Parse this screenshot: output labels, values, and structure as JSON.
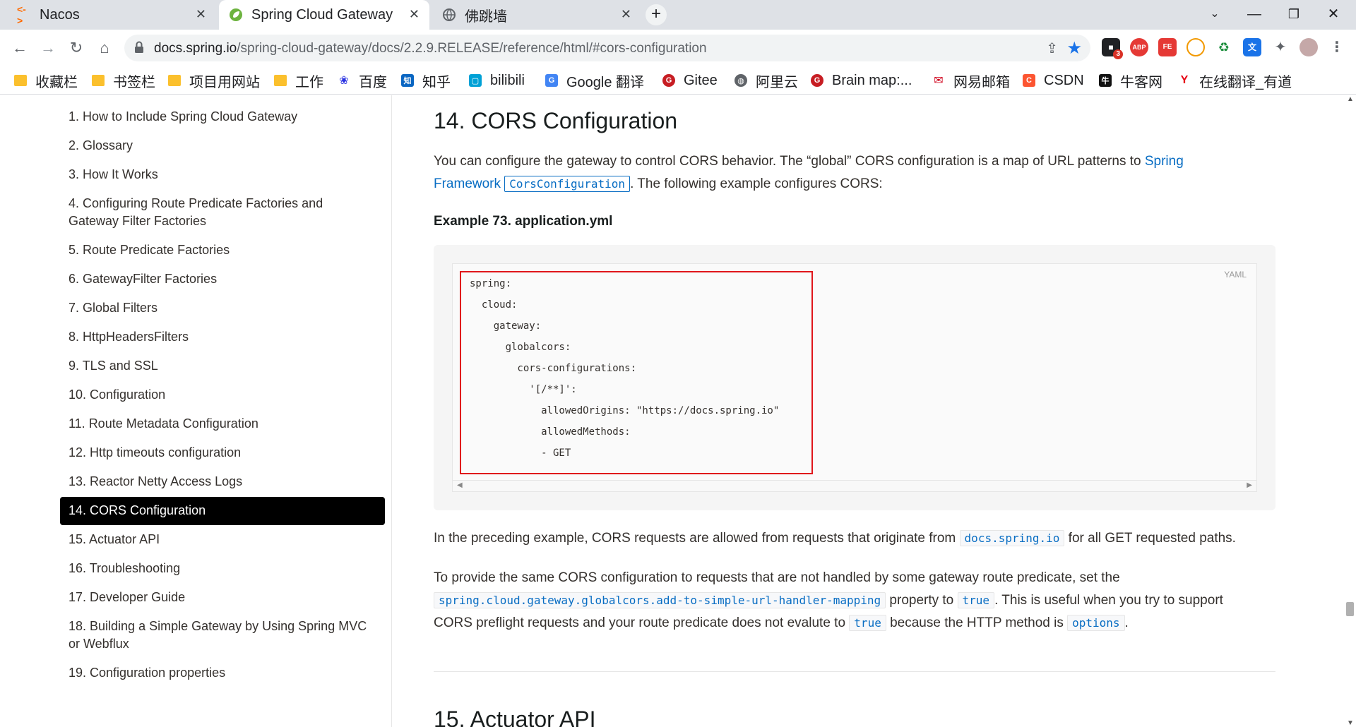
{
  "tabs": [
    {
      "title": "Nacos",
      "icon": "nacos-icon"
    },
    {
      "title": "Spring Cloud Gateway",
      "icon": "spring-leaf-icon"
    },
    {
      "title": "佛跳墙",
      "icon": "globe-icon"
    }
  ],
  "address": {
    "host": "docs.spring.io",
    "path": "/spring-cloud-gateway/docs/2.2.9.RELEASE/reference/html/#cors-configuration"
  },
  "extensions": {
    "badge_count": "3",
    "abp": "ABP",
    "fe": "FE"
  },
  "bookmarks": [
    "收藏栏",
    "书签栏",
    "项目用网站",
    "工作",
    "百度",
    "知乎",
    "bilibili",
    "Google 翻译",
    "Gitee",
    "阿里云",
    "Brain map:...",
    "网易邮箱",
    "CSDN",
    "牛客网",
    "在线翻译_有道"
  ],
  "toc": [
    {
      "label": "1. How to Include Spring Cloud Gateway",
      "active": false
    },
    {
      "label": "2. Glossary",
      "active": false
    },
    {
      "label": "3. How It Works",
      "active": false
    },
    {
      "label": "4. Configuring Route Predicate Factories and Gateway Filter Factories",
      "active": false
    },
    {
      "label": "5. Route Predicate Factories",
      "active": false
    },
    {
      "label": "6. GatewayFilter Factories",
      "active": false
    },
    {
      "label": "7. Global Filters",
      "active": false
    },
    {
      "label": "8. HttpHeadersFilters",
      "active": false
    },
    {
      "label": "9. TLS and SSL",
      "active": false
    },
    {
      "label": "10. Configuration",
      "active": false
    },
    {
      "label": "11. Route Metadata Configuration",
      "active": false
    },
    {
      "label": "12. Http timeouts configuration",
      "active": false
    },
    {
      "label": "13. Reactor Netty Access Logs",
      "active": false
    },
    {
      "label": "14. CORS Configuration",
      "active": true
    },
    {
      "label": "15. Actuator API",
      "active": false
    },
    {
      "label": "16. Troubleshooting",
      "active": false
    },
    {
      "label": "17. Developer Guide",
      "active": false
    },
    {
      "label": "18. Building a Simple Gateway by Using Spring MVC or Webflux",
      "active": false
    },
    {
      "label": "19. Configuration properties",
      "active": false
    }
  ],
  "content": {
    "heading": "14. CORS Configuration",
    "intro_a": "You can configure the gateway to control CORS behavior. The “global” CORS configuration is a map of URL patterns to ",
    "intro_link_1": "Spring",
    "intro_link_2": "Framework",
    "intro_code": "CorsConfiguration",
    "intro_b": ". The following example configures CORS:",
    "example_title": "Example 73. application.yml",
    "code_lang": "YAML",
    "code_lines": [
      "spring:",
      "  cloud:",
      "    gateway:",
      "      globalcors:",
      "        cors-configurations:",
      "          '[/**]':",
      "            allowedOrigins: \"https://docs.spring.io\"",
      "            allowedMethods:",
      "            - GET"
    ],
    "p2_a": "In the preceding example, CORS requests are allowed from requests that originate from ",
    "p2_code": "docs.spring.io",
    "p2_b": " for all GET requested paths.",
    "p3_a": "To provide the same CORS configuration to requests that are not handled by some gateway route predicate, set the",
    "p3_code1": "spring.cloud.gateway.globalcors.add-to-simple-url-handler-mapping",
    "p3_b": " property to ",
    "p3_code2": "true",
    "p3_c": ". This is useful when you try to support",
    "p3_d": "CORS preflight requests and your route predicate does not evalute to ",
    "p3_code3": "true",
    "p3_e": " because the HTTP method is ",
    "p3_code4": "options",
    "p3_f": ".",
    "next_heading": "15. Actuator API"
  }
}
